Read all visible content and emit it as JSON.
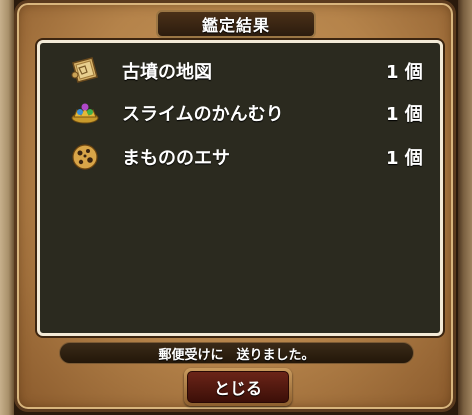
{
  "dialog": {
    "title": "鑑定結果",
    "items": [
      {
        "name": "古墳の地図",
        "qty": "1 個",
        "icon": "map-scroll-icon"
      },
      {
        "name": "スライムのかんむり",
        "qty": "1 個",
        "icon": "slime-crown-icon"
      },
      {
        "name": "まもののエサ",
        "qty": "1 個",
        "icon": "monster-food-icon"
      }
    ],
    "message": "郵便受けに　送りました。",
    "close_label": "とじる"
  },
  "colors": {
    "panel": "#b5834a",
    "list_bg": "#2b2a1f",
    "list_border": "#f3ead7",
    "button": "#5a1c12"
  }
}
